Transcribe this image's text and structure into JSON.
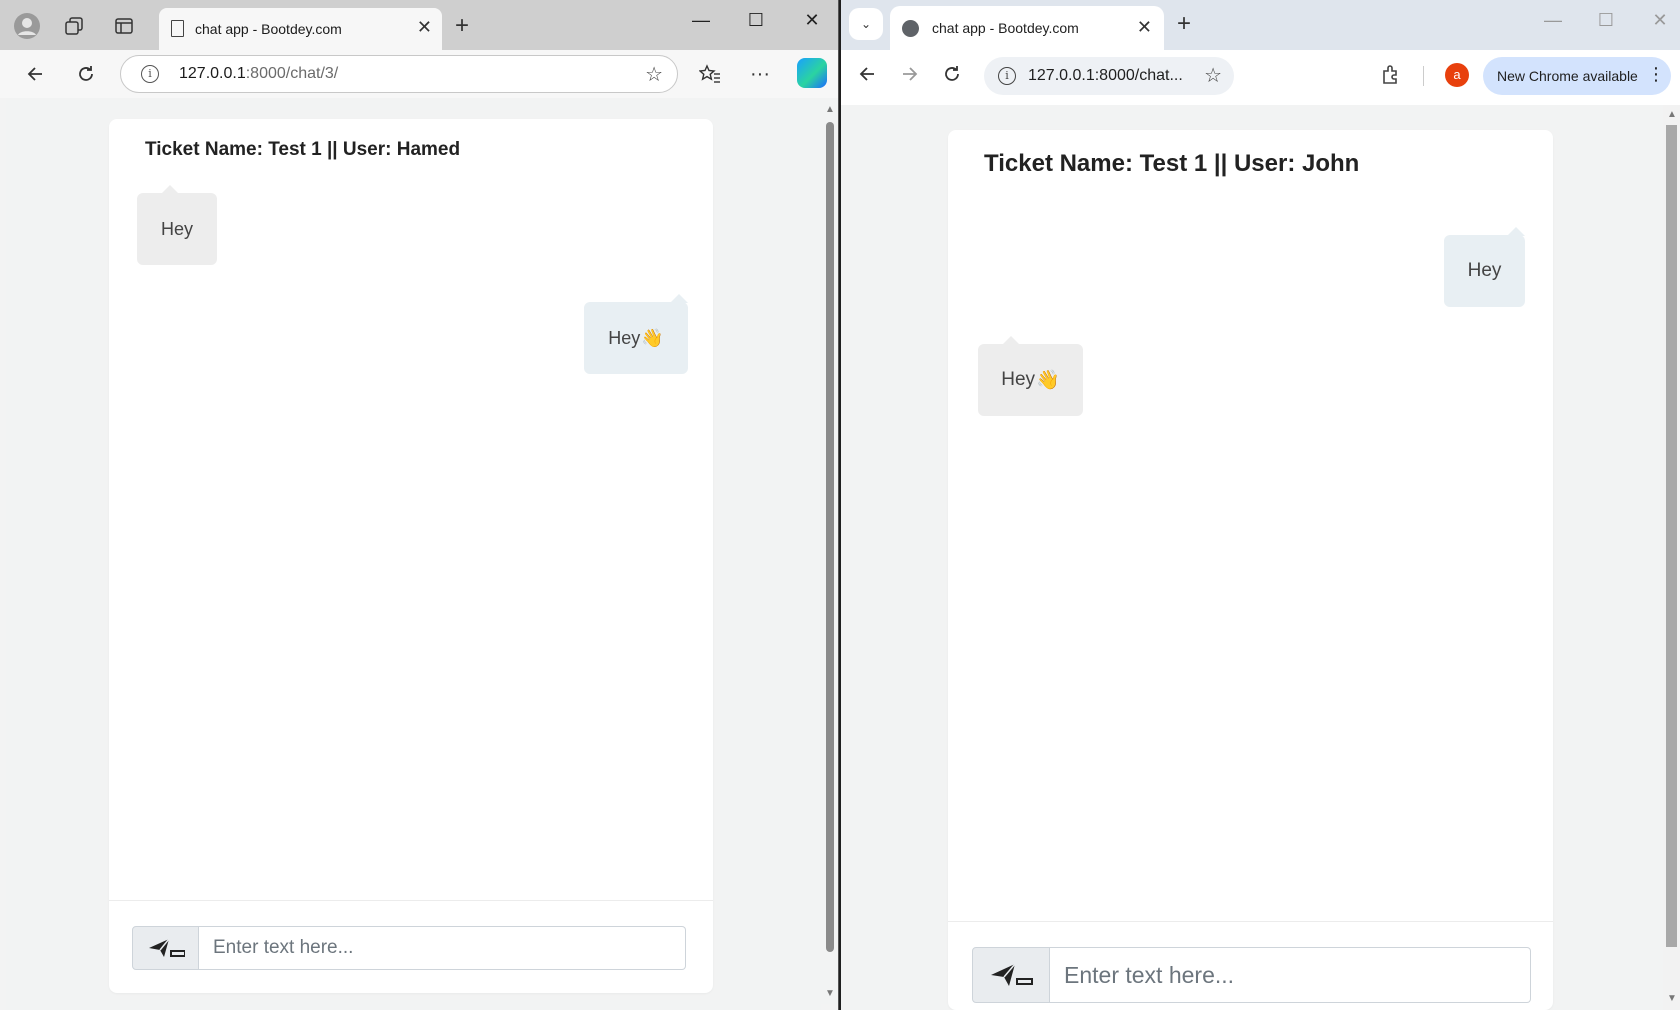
{
  "edge": {
    "tab_title": "chat app - Bootdey.com",
    "url_host": "127.0.0.1",
    "url_path": ":8000/chat/3/",
    "chat": {
      "title": "Ticket Name: Test 1 || User: Hamed",
      "messages": [
        {
          "side": "left",
          "text": "Hey"
        },
        {
          "side": "right",
          "text": "Hey",
          "emoji": "👋"
        }
      ],
      "input_placeholder": "Enter text here..."
    }
  },
  "chrome": {
    "tab_title": "chat app - Bootdey.com",
    "url": "127.0.0.1:8000/chat...",
    "profile_initial": "a",
    "update_label": "New Chrome available",
    "chat": {
      "title": "Ticket Name: Test 1 || User: John",
      "messages": [
        {
          "side": "right",
          "text": "Hey"
        },
        {
          "side": "left",
          "text": "Hey",
          "emoji": "👋"
        }
      ],
      "input_placeholder": "Enter text here..."
    }
  },
  "icons": {
    "send": "paper-plane-icon",
    "close": "close-icon",
    "new_tab": "plus-icon",
    "back": "back-arrow-icon",
    "forward": "forward-arrow-icon",
    "reload": "reload-icon",
    "star": "star-icon",
    "info": "info-icon"
  }
}
